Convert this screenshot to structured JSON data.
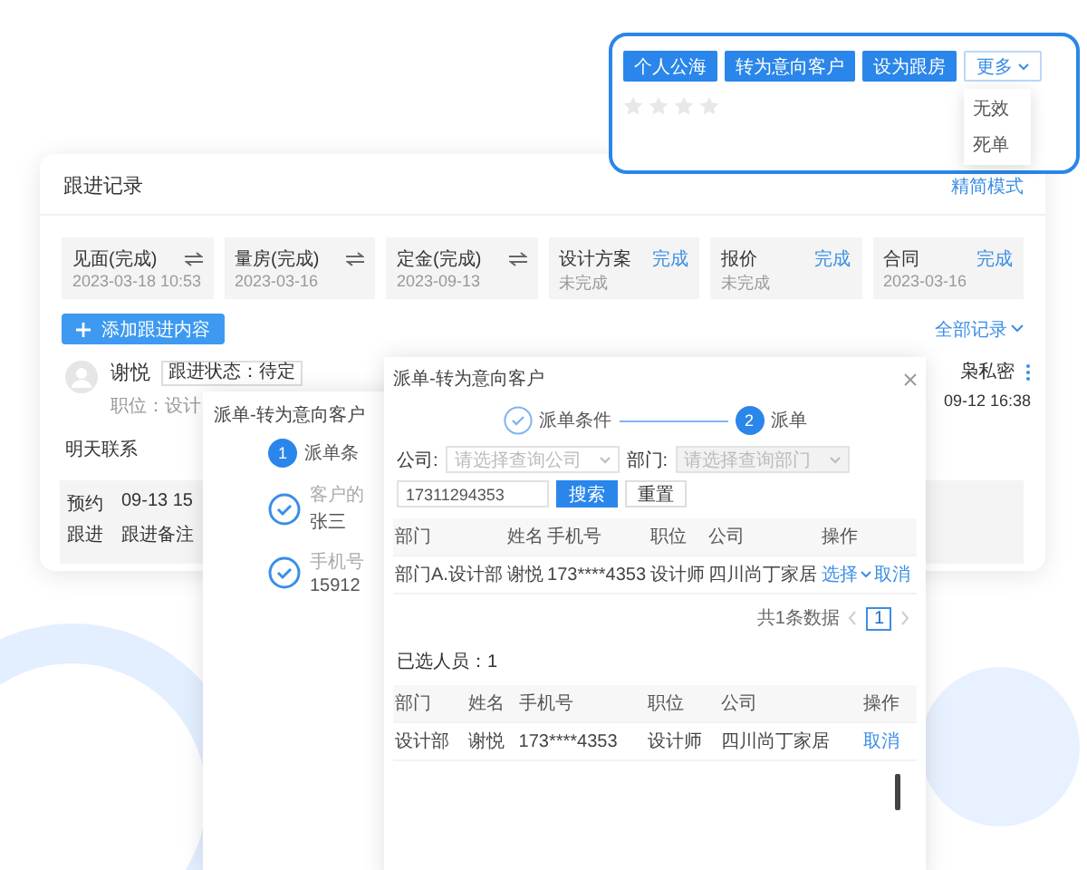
{
  "popup": {
    "buttons": [
      {
        "label": "个人公海",
        "kind": "primary"
      },
      {
        "label": "转为意向客户",
        "kind": "primary"
      },
      {
        "label": "设为跟房",
        "kind": "primary"
      },
      {
        "label": "更多",
        "kind": "dropdown"
      }
    ],
    "menu": [
      "无效",
      "死单"
    ],
    "stars": 0
  },
  "card": {
    "title": "跟进记录",
    "mode_link": "精简模式",
    "stages": [
      {
        "title": "见面(完成)",
        "kind": "swap",
        "sub": "2023-03-18 10:53"
      },
      {
        "title": "量房(完成)",
        "kind": "swap",
        "sub": "2023-03-16"
      },
      {
        "title": "定金(完成)",
        "kind": "swap",
        "sub": "2023-09-13"
      },
      {
        "title": "设计方案",
        "kind": "link",
        "link": "完成",
        "sub": "未完成"
      },
      {
        "title": "报价",
        "kind": "link",
        "link": "完成",
        "sub": "未完成"
      },
      {
        "title": "合同",
        "kind": "link",
        "link": "完成",
        "sub": "2023-03-16"
      }
    ],
    "add_button": "添加跟进内容",
    "all_records": "全部记录",
    "record": {
      "name": "谢悦",
      "status_tag": "跟进状态：待定",
      "position": "职位：设计",
      "note": "明天联系",
      "details": [
        {
          "label": "预约",
          "value": "09-13 15"
        },
        {
          "label": "跟进",
          "value": "跟进备注"
        }
      ],
      "author": "枭私密",
      "time": "09-12 16:38"
    }
  },
  "window1": {
    "title": "派单-转为意向客户",
    "steps": [
      {
        "number": "1",
        "label": "派单条",
        "done": false
      }
    ],
    "items": [
      {
        "label": "客户的",
        "value": "张三"
      },
      {
        "label": "手机号",
        "value": "15912"
      }
    ]
  },
  "window2": {
    "title": "派单-转为意向客户",
    "steps": [
      {
        "label": "派单条件",
        "done": true
      },
      {
        "number": "2",
        "label": "派单",
        "done": false
      }
    ],
    "filters": {
      "company_label": "公司:",
      "company_placeholder": "请选择查询公司",
      "dept_label": "部门:",
      "dept_placeholder": "请选择查询部门",
      "dept_disabled": true,
      "phone": "17311294353",
      "search": "搜索",
      "reset": "重置"
    },
    "columns": [
      "部门",
      "姓名",
      "手机号",
      "职位",
      "公司",
      "操作"
    ],
    "rows": [
      {
        "cells": [
          "部门A.设计部",
          "谢悦",
          "173****4353",
          "设计师",
          "四川尚丁家居"
        ],
        "actions": [
          {
            "label": "选择",
            "kind": "dropdown"
          },
          {
            "label": "取消",
            "kind": "link"
          }
        ]
      }
    ],
    "total": "共1条数据",
    "pages": [
      {
        "label": "1",
        "selected": true
      }
    ],
    "selected_title": "已选人员：1",
    "selected_columns": [
      "部门",
      "姓名",
      "手机号",
      "职位",
      "公司",
      "操作"
    ],
    "selected_rows": [
      {
        "cells": [
          "设计部",
          "谢悦",
          "173****4353",
          "设计师",
          "四川尚丁家居"
        ],
        "action": "取消"
      }
    ]
  }
}
